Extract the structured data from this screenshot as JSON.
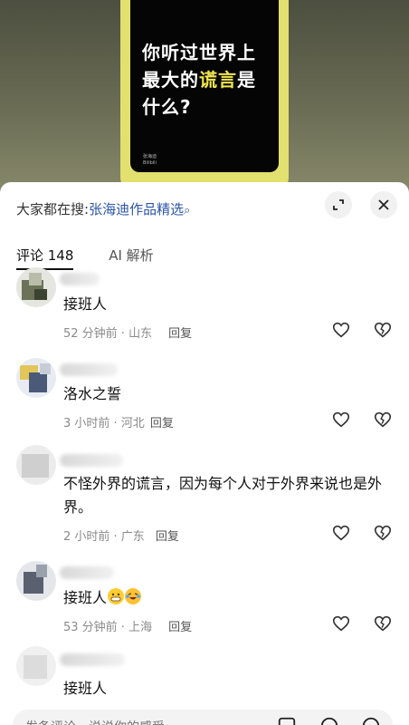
{
  "video": {
    "line1": "你听过世界上",
    "line2_white": "最大的",
    "line2_yellow": "谎言",
    "line2_end": "是",
    "line3": "什么?",
    "tiny_meta_1": "张海迪",
    "tiny_meta_2": "Bilibili"
  },
  "search": {
    "prefix": "大家都在搜:",
    "query": "张海迪作品精选"
  },
  "tabs": {
    "comments": "评论 148",
    "ai": "AI 解析"
  },
  "comments": [
    {
      "text": "接班人",
      "time": "52 分钟前 · 山东",
      "reply": "回复"
    },
    {
      "text": "洛水之誓",
      "time": "3 小时前 · 河北",
      "reply": "回复"
    },
    {
      "text": "不怪外界的谎言，因为每个人对于外界来说也是外界。",
      "time": "2 小时前 · 广东",
      "reply": "回复"
    },
    {
      "text": "接班人",
      "time": "53 分钟前 · 上海",
      "reply": "回复"
    },
    {
      "text": "接班人"
    }
  ],
  "bottom": {
    "placeholder": "发条评论，说说你的感受"
  },
  "colors": {
    "accent_link": "#2c55a8",
    "highlight_yellow": "#f2e651"
  }
}
